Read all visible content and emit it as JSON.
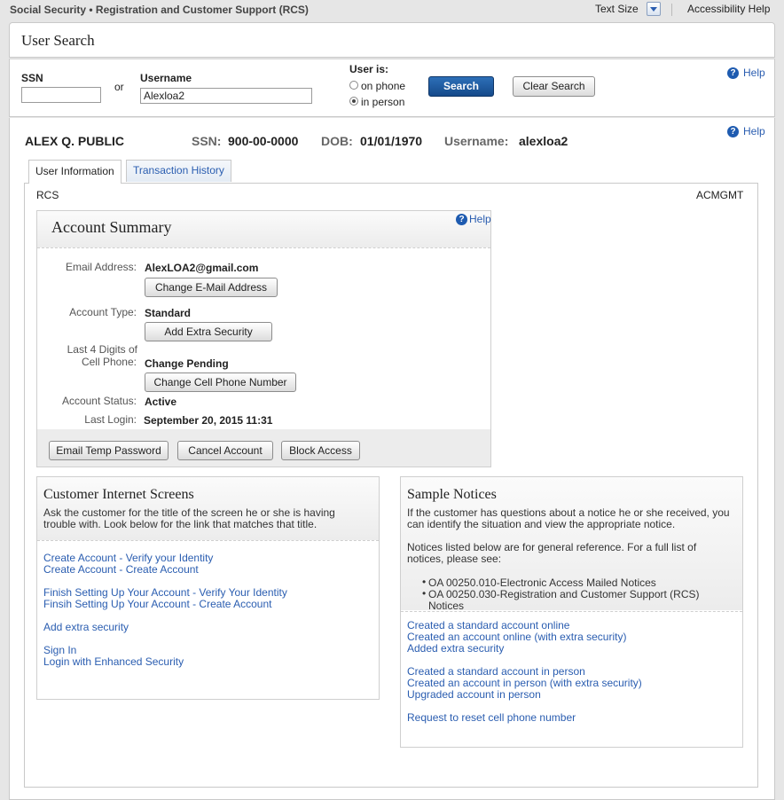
{
  "topbar": {
    "title": "Social Security • Registration and Customer Support (RCS)",
    "text_size_label": "Text Size",
    "accessibility_help": "Accessibility Help"
  },
  "user_search": {
    "title": "User Search",
    "ssn_label": "SSN",
    "ssn_value": "",
    "or_label": "or",
    "username_label": "Username",
    "username_value": "Alexloa2",
    "user_is_label": "User is:",
    "options": [
      "on phone",
      "in person"
    ],
    "selected_option": "in person",
    "search_button": "Search",
    "clear_button": "Clear Search",
    "help": "Help"
  },
  "customer": {
    "name": "ALEX Q. PUBLIC",
    "ssn_label": "SSN:",
    "ssn_value": "900-00-0000",
    "dob_label": "DOB:",
    "dob_value": "01/01/1970",
    "username_label": "Username:",
    "username_value": "alexloa2",
    "help": "Help"
  },
  "tabs": [
    {
      "label": "User Information",
      "active": true
    },
    {
      "label": "Transaction History",
      "active": false
    }
  ],
  "content": {
    "left_code": "RCS",
    "right_code": "ACMGMT"
  },
  "account_summary": {
    "title": "Account Summary",
    "help": "Help",
    "email_label": "Email Address:",
    "email_value": "AlexLOA2@gmail.com",
    "change_email_button": "Change E-Mail Address",
    "account_type_label": "Account Type:",
    "account_type_value": "Standard",
    "add_security_button": "Add Extra Security",
    "cell_label_line1": "Last 4 Digits of",
    "cell_label_line2": "Cell Phone:",
    "cell_value": "Change Pending",
    "change_cell_button": "Change Cell Phone Number",
    "status_label": "Account Status:",
    "status_value": "Active",
    "last_login_label": "Last Login:",
    "last_login_value": "September 20, 2015 11:31",
    "email_temp_button": "Email Temp Password",
    "cancel_button": "Cancel Account",
    "block_button": "Block Access"
  },
  "customer_screens": {
    "title": "Customer Internet Screens",
    "desc_line1": "Ask the customer for the title of the screen he or she is having",
    "desc_line2": "trouble with. Look below for the link that matches that title.",
    "links": [
      "Create Account - Verify your Identity",
      "Create Account - Create Account",
      "Finish Setting Up Your Account - Verify Your Identity",
      "Finsih Setting Up Your Account - Create Account",
      "Add extra security",
      "Sign In",
      "Login with Enhanced Security"
    ]
  },
  "sample_notices": {
    "title": "Sample Notices",
    "desc_line1": "If the customer has questions about a notice he or she received, you",
    "desc_line2": "can identify the situation and view the appropriate notice.",
    "ref_line1": "Notices listed below are for general reference. For a full list of",
    "ref_line2": "notices, please see:",
    "bullets": [
      "OA 00250.010-Electronic Access Mailed Notices",
      "OA 00250.030-Registration and Customer Support (RCS)",
      "Notices"
    ],
    "links": [
      "Created a standard account online",
      "Created an account online (with extra security)",
      "Added extra security",
      "Created a standard account in person",
      "Created an account in person (with extra security)",
      "Upgraded account in person",
      "Request to reset cell phone number"
    ]
  }
}
